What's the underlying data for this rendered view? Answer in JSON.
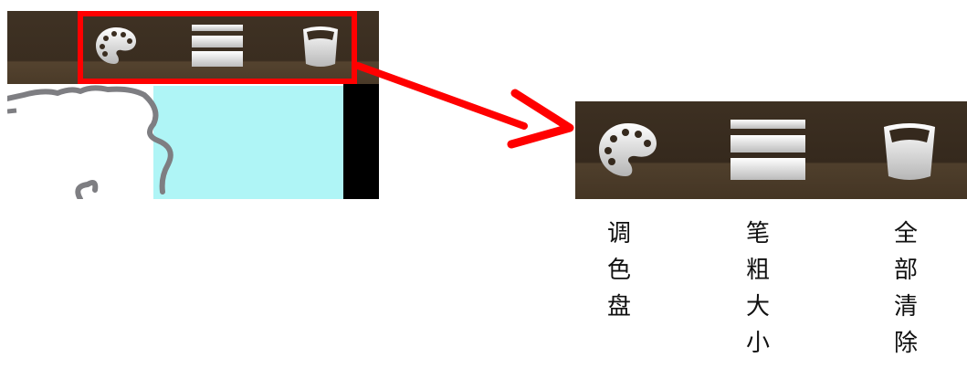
{
  "toolbar": {
    "buttons": [
      {
        "name": "palette",
        "icon": "palette-icon",
        "label": "调色盘"
      },
      {
        "name": "brush-size",
        "icon": "brush-size-icon",
        "label": "笔粗大小"
      },
      {
        "name": "clear-all",
        "icon": "trash-icon",
        "label": "全部清除"
      }
    ]
  },
  "colors": {
    "toolbar_dark": "#3a2d20",
    "highlight": "#ff0000",
    "arrow": "#ff0000",
    "canvas_cyan": "#aff5f6"
  }
}
